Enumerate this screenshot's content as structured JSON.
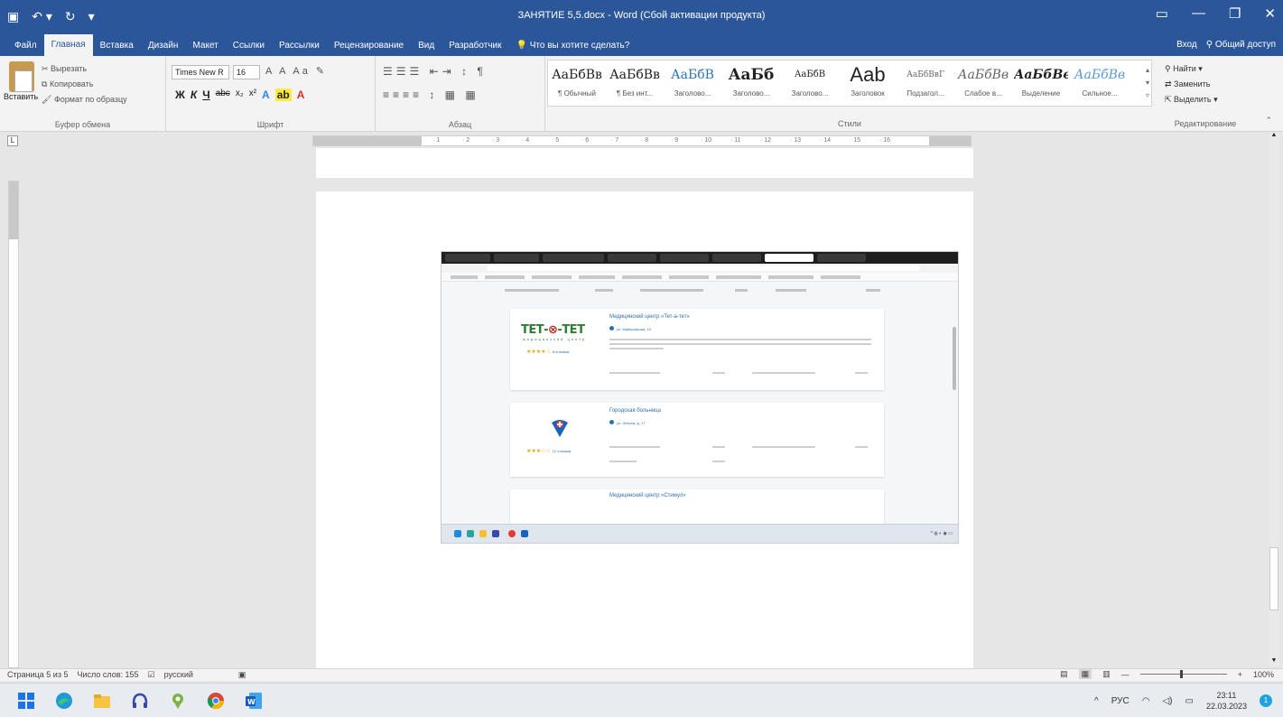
{
  "window": {
    "title": "ЗАНЯТИЕ 5,5.docx - Word (Сбой активации продукта)",
    "controls": [
      "minimize",
      "maximize",
      "close"
    ]
  },
  "quick_access": [
    "save-icon",
    "undo-icon",
    "redo-icon"
  ],
  "ribbon_tabs": [
    "Файл",
    "Главная",
    "Вставка",
    "Дизайн",
    "Макет",
    "Ссылки",
    "Рассылки",
    "Рецензирование",
    "Вид",
    "Разработчик",
    "Что вы хотите сделать?"
  ],
  "active_tab": "Главная",
  "tabs_right": {
    "signin": "Вход",
    "share": "Общий доступ"
  },
  "clipboard": {
    "paste": "Вставить",
    "cut": "Вырезать",
    "copy": "Копировать",
    "format_painter": "Формат по образцу",
    "label": "Буфер обмена"
  },
  "font": {
    "name": "Times New R",
    "size": "16",
    "label": "Шрифт",
    "format_buttons": [
      "Ж",
      "К",
      "Ч",
      "abc",
      "x₂",
      "x²"
    ]
  },
  "paragraph": {
    "label": "Абзац"
  },
  "styles": {
    "label": "Стили",
    "items": [
      {
        "sample": "АаБбВв",
        "name": "¶ Обычный"
      },
      {
        "sample": "АаБбВв",
        "name": "¶ Без инт..."
      },
      {
        "sample": "АаБбВ",
        "name": "Заголово..."
      },
      {
        "sample": "АаБб",
        "name": "Заголово..."
      },
      {
        "sample": "АаБбВ",
        "name": "Заголово..."
      },
      {
        "sample": "Aab",
        "name": "Заголовок"
      },
      {
        "sample": "АаБбВвГ",
        "name": "Подзагол..."
      },
      {
        "sample": "АаБбВв",
        "name": "Слабое в..."
      },
      {
        "sample": "АаБбВв",
        "name": "Выделение"
      },
      {
        "sample": "АаБбВв",
        "name": "Сильное..."
      }
    ]
  },
  "editing": {
    "find": "Найти",
    "replace": "Заменить",
    "select": "Выделить",
    "label": "Редактирование"
  },
  "ruler_ticks": [
    "1",
    "2",
    "3",
    "4",
    "5",
    "6",
    "7",
    "8",
    "9",
    "10",
    "11",
    "12",
    "13",
    "14",
    "15",
    "16"
  ],
  "embedded": {
    "cards": [
      {
        "title": "Медицинский центр «Тет-а-тет»",
        "address": "ул. Майоровская, 10",
        "logo_text": [
          "ТЕТ-",
          "⊗",
          "-ТЕТ"
        ],
        "logo_sub": "медицинский центр",
        "rating": "★★★★☆",
        "reviews": "8 отзывов"
      },
      {
        "title": "Городская больница",
        "address": "ул. Ленина, д. 17",
        "rating": "★★★☆☆",
        "reviews": "12 отзывов"
      },
      {
        "title": "Медицинский центр «Стимул»"
      }
    ]
  },
  "statusbar": {
    "page": "Страница 5 из 5",
    "words": "Число слов: 155",
    "language": "русский",
    "zoom": "100%"
  },
  "taskbar": {
    "lang": "РУС",
    "time": "23:11",
    "date": "22.03.2023",
    "notifications": "1"
  },
  "colors": {
    "word_blue": "#2b579a",
    "ribbon_bg": "#f3f3f3",
    "page_bg": "#e6e6e6"
  }
}
